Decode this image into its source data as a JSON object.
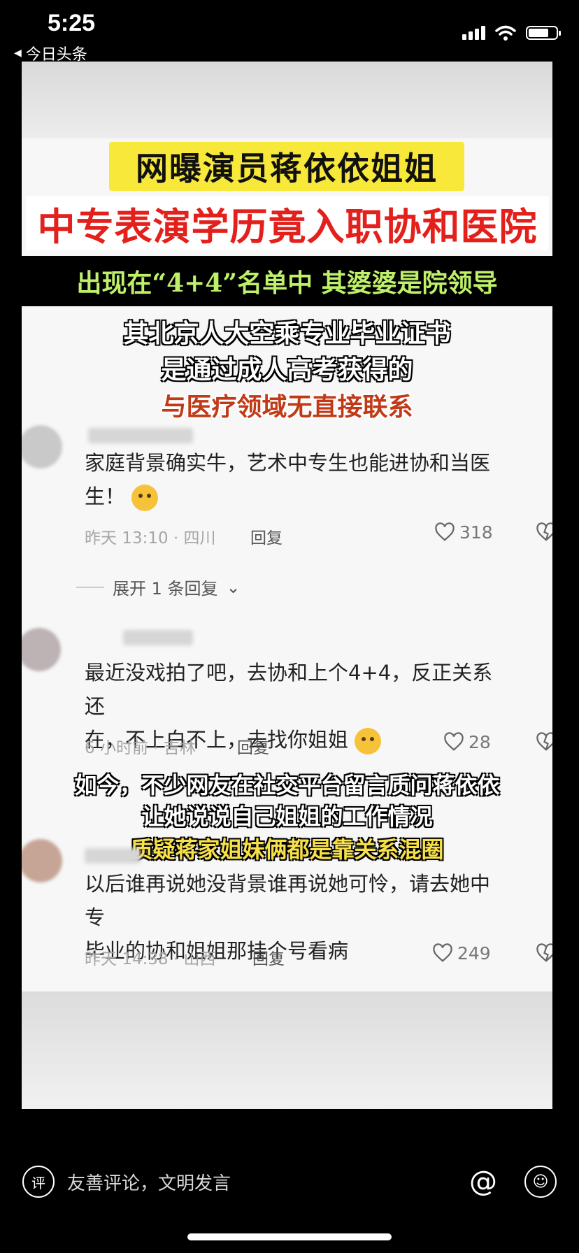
{
  "status_bar": {
    "time": "5:25",
    "back_app": "今日头条"
  },
  "video": {
    "title_line1": "网曝演员蒋依依姐姐",
    "title_line2": "中专表演学历竟入职协和医院",
    "title_line3": "出现在“4+4”名单中 其婆婆是院领导",
    "caption1_line1": "其北京人大空乘专业毕业证书",
    "caption1_line2": "是通过成人高考获得的",
    "caption1_line3": "与医疗领域无直接联系",
    "caption2_line1": "如今，不少网友在社交平台留言质问蒋依依",
    "caption2_line2": "让她说说自己姐姐的工作情况",
    "caption2_line3": "质疑蒋家姐妹俩都是靠关系混圈"
  },
  "comments": [
    {
      "text_line1": "家庭背景确实牛，艺术中专生也能进协和当医",
      "text_line2": "生！",
      "meta": "昨天 13:10 · 四川",
      "reply": "回复",
      "likes": "318"
    },
    {
      "text_line1": "最近没戏拍了吧，去协和上个4+4，反正关系还",
      "text_line2": "在，不上白不上，去找你姐姐",
      "meta": "6 小时前 · 吉林",
      "reply": "回复",
      "likes": "28"
    },
    {
      "text_line1": "以后谁再说她没背景谁再说她可怜，请去她中专",
      "text_line2": "毕业的协和姐姐那挂个号看病",
      "meta": "昨天 14:38 · 山西",
      "reply": "回复",
      "likes": "249"
    }
  ],
  "expand_replies": "展开 1 条回复",
  "input": {
    "icon_glyph": "评",
    "placeholder": "友善评论，文明发言",
    "at_glyph": "@"
  },
  "icons": [
    "signal-icon",
    "wifi-icon",
    "battery-icon",
    "heart-icon",
    "dislike-icon",
    "comment-icon",
    "at-icon",
    "emoji-icon"
  ]
}
